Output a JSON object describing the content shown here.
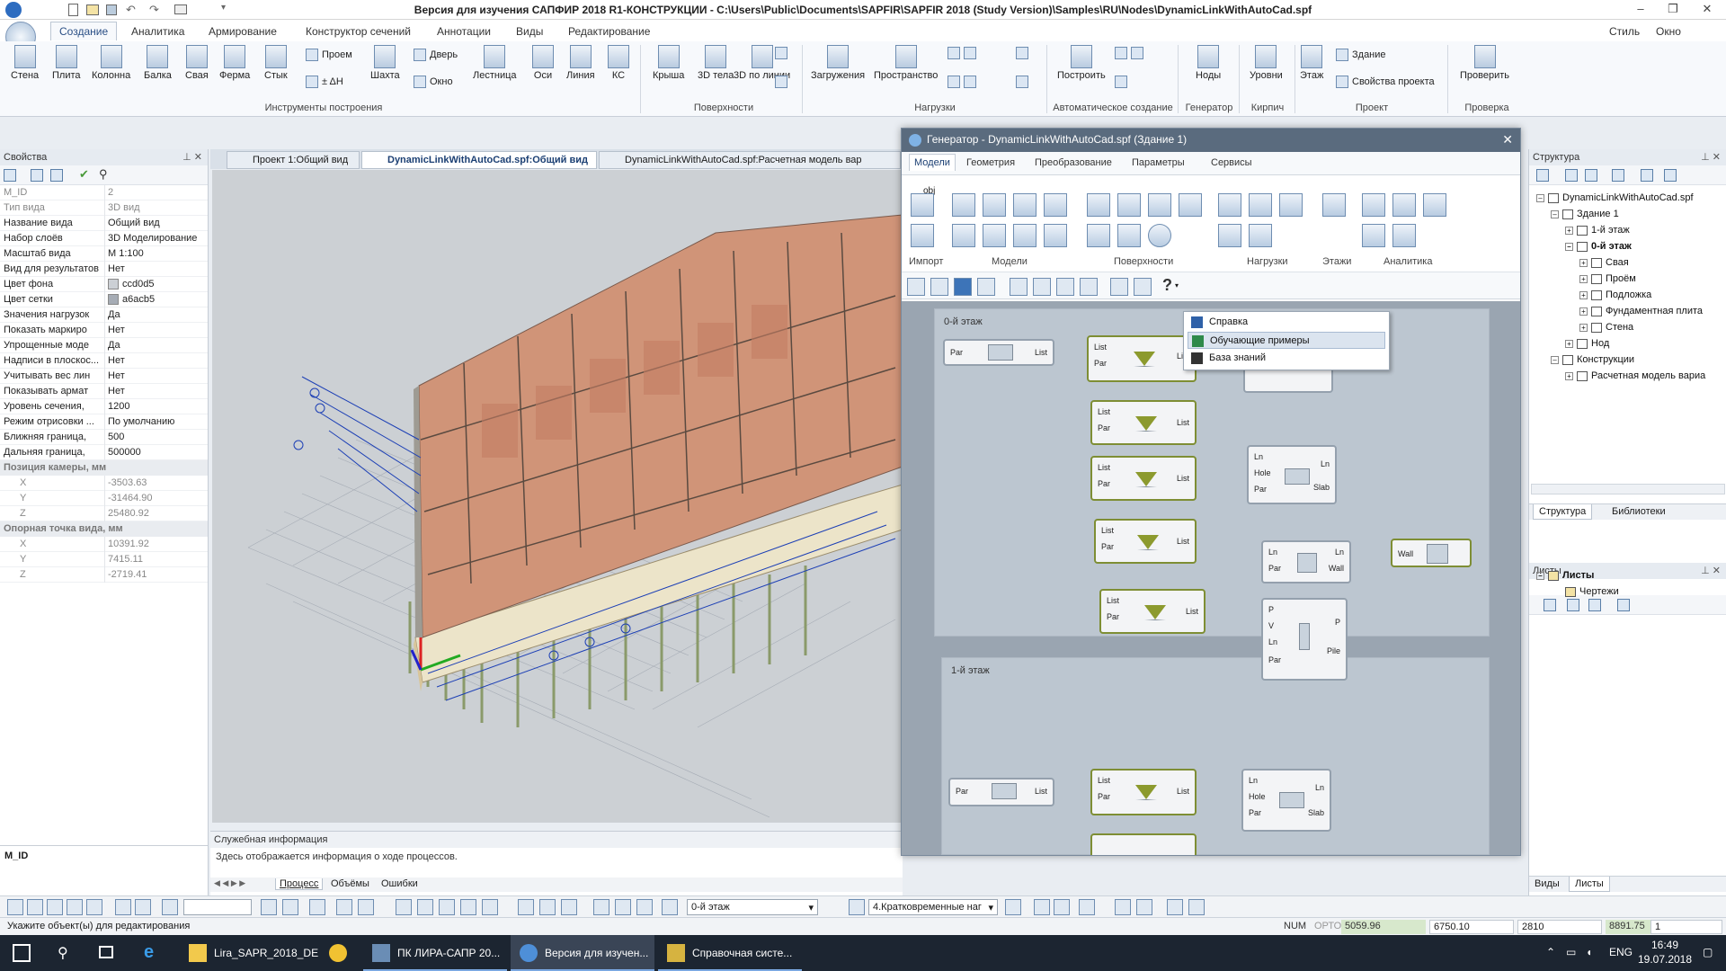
{
  "titlebar": {
    "title": "Версия для изучения САПФИР 2018 R1-КОНСТРУКЦИИ - C:\\Users\\Public\\Documents\\SAPFIR\\SAPFIR 2018 (Study Version)\\Samples\\RU\\Nodes\\DynamicLinkWithAutoCad.spf",
    "style": "Стиль",
    "window": "Окно"
  },
  "ribbon_tabs": [
    "Создание",
    "Аналитика",
    "Армирование",
    "Конструктор сечений",
    "Аннотации",
    "Виды",
    "Редактирование"
  ],
  "ribbon": {
    "build": [
      "Стена",
      "Плита",
      "Колонна",
      "Балка",
      "Свая",
      "Ферма",
      "Стык",
      "Проем",
      "± ΔH",
      "Шахта",
      "Дверь",
      "Окно",
      "Лестница",
      "Оси",
      "Линия",
      "КС"
    ],
    "surfaces": [
      "Крыша",
      "3D тела",
      "3D по линии"
    ],
    "loads": [
      "Загружения",
      "Пространство"
    ],
    "auto": [
      "Построить"
    ],
    "gen": [
      "Ноды"
    ],
    "kirpich": [
      "Уровни"
    ],
    "project": [
      "Этаж",
      "Здание",
      "Свойства проекта"
    ],
    "check": [
      "Проверить"
    ],
    "groups": [
      "Инструменты построения",
      "Поверхности",
      "Нагрузки",
      "Автоматическое создание",
      "Генератор",
      "Кирпич",
      "Проект",
      "Проверка"
    ]
  },
  "props": {
    "header": "Свойства",
    "rows": [
      {
        "k": "M_ID",
        "v": "2"
      },
      {
        "k": "Тип вида",
        "v": "3D вид"
      },
      {
        "k": "Название вида",
        "v": "Общий вид"
      },
      {
        "k": "Набор слоёв",
        "v": "3D Моделирование"
      },
      {
        "k": "Масштаб вида",
        "v": "М 1:100"
      },
      {
        "k": "Вид для результатов",
        "v": "Нет"
      },
      {
        "k": "Цвет фона",
        "v": "ccd0d5"
      },
      {
        "k": "Цвет сетки",
        "v": "a6acb5"
      },
      {
        "k": "Значения нагрузок",
        "v": "Да"
      },
      {
        "k": "Показать маркиро",
        "v": "Нет"
      },
      {
        "k": "Упрощенные моде",
        "v": "Да"
      },
      {
        "k": "Надписи в плоскос...",
        "v": "Нет"
      },
      {
        "k": "Учитывать вес лин",
        "v": "Нет"
      },
      {
        "k": "Показывать армат",
        "v": "Нет"
      },
      {
        "k": "Уровень сечения,",
        "v": "1200"
      },
      {
        "k": "Режим отрисовки ...",
        "v": "По умолчанию"
      },
      {
        "k": "Ближняя граница,",
        "v": "500"
      },
      {
        "k": "Дальняя граница,",
        "v": "500000"
      }
    ],
    "cam_header": "Позиция камеры, мм",
    "cam": [
      {
        "k": "X",
        "v": "-3503.63"
      },
      {
        "k": "Y",
        "v": "-31464.90"
      },
      {
        "k": "Z",
        "v": "25480.92"
      }
    ],
    "pivot_header": "Опорная точка вида, мм",
    "pivot": [
      {
        "k": "X",
        "v": "10391.92"
      },
      {
        "k": "Y",
        "v": "7415.11"
      },
      {
        "k": "Z",
        "v": "-2719.41"
      }
    ],
    "footer": "M_ID",
    "colors": {
      "bg": "#ccd0d5",
      "grid": "#a6acb5"
    }
  },
  "doc_tabs": [
    "Проект 1:Общий вид",
    "DynamicLinkWithAutoCad.spf:Общий вид",
    "DynamicLinkWithAutoCad.spf:Расчетная модель вар"
  ],
  "info": {
    "header": "Служебная информация",
    "text": "Здесь отображается информация о ходе процессов.",
    "tabs": [
      "Процесс",
      "Объёмы",
      "Ошибки"
    ]
  },
  "generator": {
    "title": "Генератор - DynamicLinkWithAutoCad.spf (Здание 1)",
    "tabs": [
      "Модели",
      "Геометрия",
      "Преобразование",
      "Параметры",
      "Сервисы"
    ],
    "groups": [
      "Импорт",
      "Модели",
      "Поверхности",
      "Нагрузки",
      "Этажи",
      "Аналитика"
    ],
    "import_label": "obj",
    "floors": [
      "0-й этаж",
      "1-й этаж"
    ],
    "ports": {
      "par": "Par",
      "list": "List",
      "ln": "Ln",
      "hole": "Hole",
      "slab": "Slab",
      "wall": "Wall",
      "p": "P",
      "v": "V",
      "pile": "Pile"
    },
    "help_menu": [
      "Справка",
      "Обучающие примеры",
      "База знаний"
    ]
  },
  "structure": {
    "header": "Структура",
    "tree": [
      "DynamicLinkWithAutoCad.spf",
      "Здание 1",
      "1-й этаж",
      "0-й этаж",
      "Свая",
      "Проём",
      "Подложка",
      "Фундаментная плита",
      "Стена",
      "Нод",
      "Конструкции",
      "Расчетная модель вариа"
    ],
    "tabs": [
      "Структура",
      "Библиотеки"
    ]
  },
  "sheets": {
    "header": "Листы",
    "tree": [
      "Листы",
      "Чертежи"
    ],
    "tabs": [
      "Виды",
      "Листы"
    ]
  },
  "lowbar": {
    "floor": "0-й этаж",
    "load": "4.Кратковременные наг"
  },
  "status": {
    "hint": "Укажите объект(ы) для редактирования",
    "num": "NUM",
    "orto": "ОРТО",
    "x": "5059.96",
    "y": "6750.10",
    "z": "2810",
    "d": "8891.75",
    "n": "1"
  },
  "taskbar": {
    "apps": [
      "Lira_SAPR_2018_DE",
      "ПК ЛИРА-САПР 20...",
      "Версия для изучен...",
      "Справочная систе..."
    ],
    "lang": "ENG",
    "time": "16:49",
    "date": "19.07.2018"
  }
}
